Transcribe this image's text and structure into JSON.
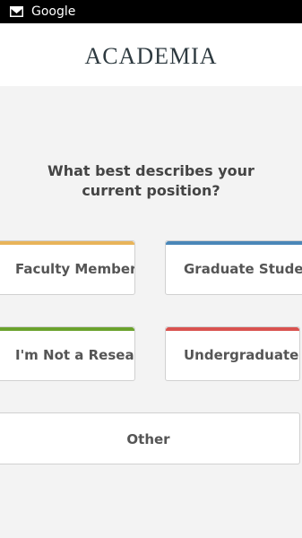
{
  "status_bar": {
    "notification_icon": "mail-icon",
    "app_name": "Google"
  },
  "header": {
    "logo_text": "ACADEMIA"
  },
  "question": {
    "line1": "What best describes your",
    "line2": "current position?"
  },
  "options": [
    {
      "label": "Faculty Member",
      "accent": "#e8b45a"
    },
    {
      "label": "Graduate Student",
      "accent": "#4a87b8"
    },
    {
      "label": "I'm Not a Researcher",
      "accent": "#6aa22c"
    },
    {
      "label": "Undergraduate",
      "accent": "#d9524f"
    },
    {
      "label": "Other",
      "accent": null
    }
  ]
}
